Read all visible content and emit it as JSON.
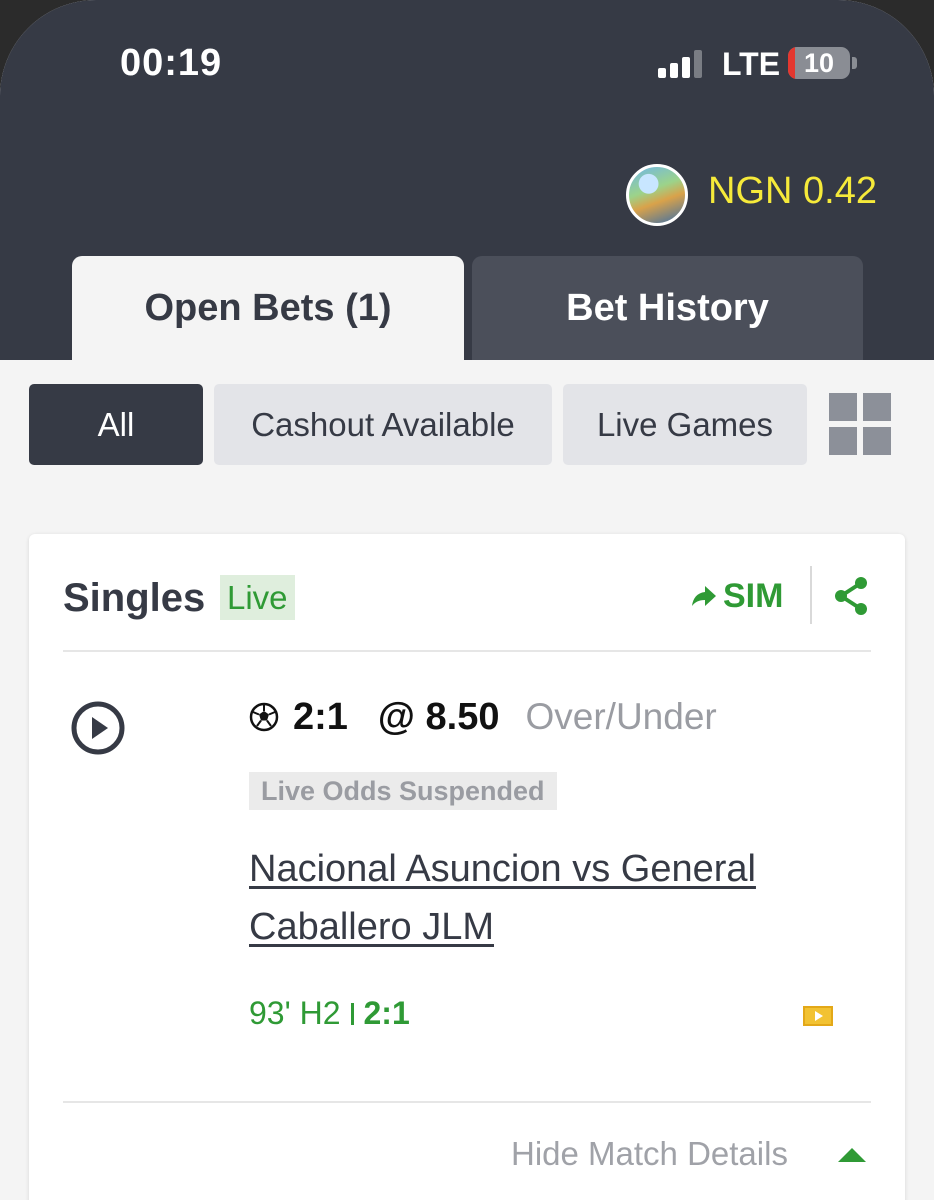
{
  "status_bar": {
    "time": "00:19",
    "network": "LTE",
    "battery": "10"
  },
  "header": {
    "balance": "NGN 0.42"
  },
  "tabs": [
    {
      "label": "Open Bets (1)",
      "active": true
    },
    {
      "label": "Bet History",
      "active": false
    }
  ],
  "filters": [
    {
      "label": "All",
      "active": true
    },
    {
      "label": "Cashout Available",
      "active": false
    },
    {
      "label": "Live Games",
      "active": false
    }
  ],
  "bet_card": {
    "title": "Singles",
    "live_badge": "Live",
    "sim_label": "SIM",
    "selection": "2:1",
    "odds": "@ 8.50",
    "market": "Over/Under",
    "status": "Live Odds Suspended",
    "match": "Nacional Asuncion vs General Caballero JLM",
    "match_time": "93' H2",
    "live_score": "2:1",
    "toggle_details": "Hide Match Details"
  },
  "colors": {
    "header_bg": "#363a45",
    "accent_green": "#2f9a35",
    "balance_yellow": "#f6ea3a"
  }
}
